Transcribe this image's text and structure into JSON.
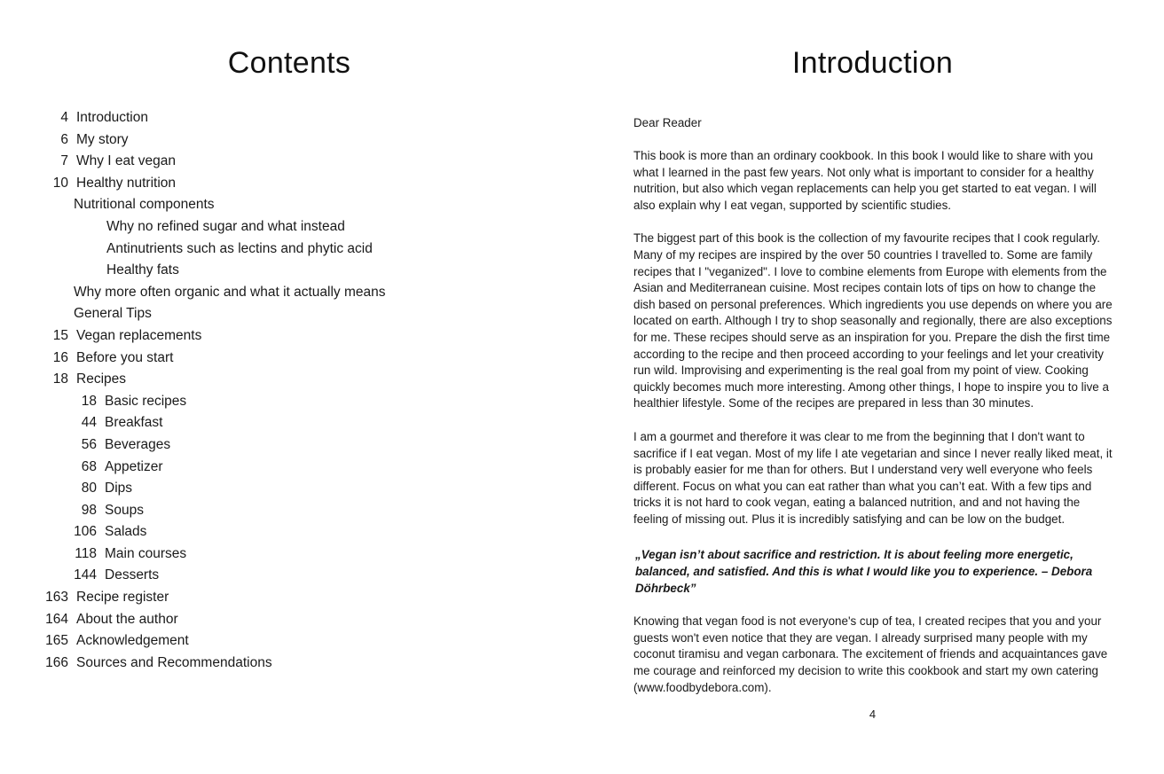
{
  "left_page": {
    "heading": "Contents",
    "entries": [
      {
        "level": 0,
        "page": "4",
        "title": "Introduction"
      },
      {
        "level": 0,
        "page": "6",
        "title": "My story"
      },
      {
        "level": 0,
        "page": "7",
        "title": "Why I eat vegan"
      },
      {
        "level": 0,
        "page": "10",
        "title": "Healthy nutrition"
      },
      {
        "level": 1,
        "page": "",
        "title": "Nutritional components"
      },
      {
        "level": 2,
        "page": "",
        "title": "Why no refined sugar and what instead"
      },
      {
        "level": 2,
        "page": "",
        "title": "Antinutrients such as lectins and phytic acid"
      },
      {
        "level": 2,
        "page": "",
        "title": "Healthy fats"
      },
      {
        "level": 1,
        "page": "",
        "title": "Why more often organic and what it actually means"
      },
      {
        "level": 1,
        "page": "",
        "title": "General Tips"
      },
      {
        "level": 0,
        "page": "15",
        "title": "Vegan replacements"
      },
      {
        "level": 0,
        "page": "16",
        "title": "Before you start"
      },
      {
        "level": 0,
        "page": "18",
        "title": "Recipes"
      },
      {
        "level": 3,
        "page": "18",
        "title": "Basic recipes"
      },
      {
        "level": 3,
        "page": "44",
        "title": "Breakfast"
      },
      {
        "level": 3,
        "page": "56",
        "title": "Beverages"
      },
      {
        "level": 3,
        "page": "68",
        "title": "Appetizer"
      },
      {
        "level": 3,
        "page": "80",
        "title": "Dips"
      },
      {
        "level": 3,
        "page": "98",
        "title": "Soups"
      },
      {
        "level": 3,
        "page": "106",
        "title": "Salads"
      },
      {
        "level": 3,
        "page": "118",
        "title": "Main courses"
      },
      {
        "level": 3,
        "page": "144",
        "title": "Desserts"
      },
      {
        "level": 0,
        "page": "163",
        "title": "Recipe register"
      },
      {
        "level": 0,
        "page": "164",
        "title": "About the author"
      },
      {
        "level": 0,
        "page": "165",
        "title": "Acknowledgement"
      },
      {
        "level": 0,
        "page": "166",
        "title": "Sources and Recommendations"
      }
    ]
  },
  "right_page": {
    "heading": "Introduction",
    "salutation": "Dear Reader",
    "paragraph_1": "This book is more than an ordinary cookbook. In this book I would like to share with you what I learned in the past few years. Not only what is important to consider for a healthy nutrition, but also which vegan replacements can help you get started to eat vegan. I will also explain why I eat vegan, supported by scientific studies.",
    "paragraph_2": "The biggest part of this book is the collection of my favourite recipes that I cook regularly. Many of my recipes are inspired by the over 50 countries I travelled to. Some are family recipes that I \"veganized\". I love to combine elements from Europe with elements from the Asian and Mediterranean cuisine. Most recipes contain lots of tips on how to change the dish based on personal preferences. Which ingredients you use depends on where you are located on earth. Although I try to shop seasonally and regionally, there are also exceptions for me. These recipes should serve as an inspiration for you. Prepare the dish the first time according to the recipe and then proceed according to your feelings and let your creativity run wild. Improvising and experimenting is the real goal from my point of view. Cooking quickly becomes much more interesting. Among other things, I hope to inspire you to live a healthier lifestyle. Some of the recipes are prepared in less than 30 minutes.",
    "paragraph_3": "I am a gourmet and therefore it was clear to me from the beginning that I don't want to sacrifice if I eat vegan. Most of my life I ate vegetarian and since I never really liked meat, it is probably easier for me than for others. But I understand very well everyone who feels different. Focus on what you can eat rather than what you can’t eat. With a few tips and tricks it is not hard to cook vegan, eating a balanced nutrition, and and not having the feeling of missing out. Plus it is incredibly satisfying and can be low on the budget.",
    "quote": "„Vegan isn’t about sacrifice and restriction. It is about feeling more energetic, balanced, and satisfied. And this is what I would like you to experience. – Debora Döhrbeck”",
    "paragraph_4": "Knowing that vegan food is not everyone's cup of tea, I created recipes that you and your guests won't even notice that they are vegan. I already surprised many people with my coconut tiramisu and vegan carbonara. The excitement of friends and acquaintances gave me courage and reinforced my decision to write this cookbook and start my own catering (www.foodbydebora.com).",
    "folio": "4"
  },
  "colors": {
    "text": "#1a1a1a",
    "gutter": "#c8c8c8",
    "background": "#ffffff"
  }
}
